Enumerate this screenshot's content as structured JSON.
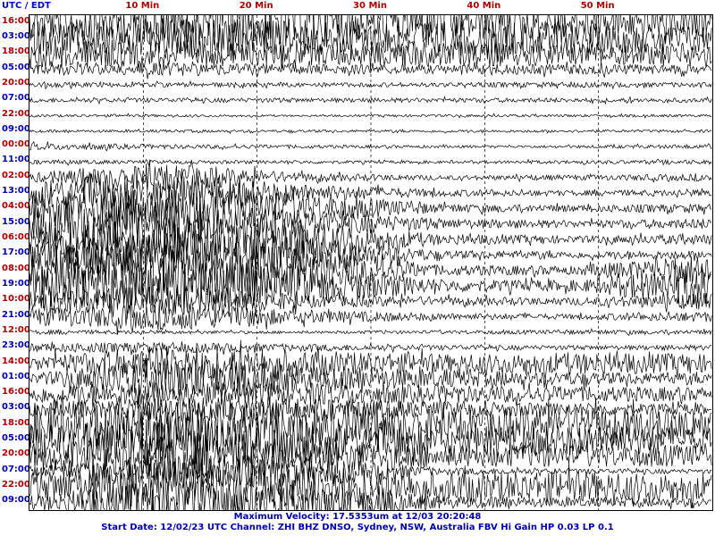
{
  "header": {
    "timezone_label": "UTC / EDT"
  },
  "footer": {
    "max_velocity_text": "Maximum Velocity: 17.5353um at 12/03 20:20:48",
    "info_text": "Start Date: 12/02/23 UTC Channel: ZHI  BHZ  DNSO, Sydney, NSW, Australia  FBV Hi Gain HP 0.03  LP 0.1"
  },
  "chart_data": {
    "type": "line",
    "title": "",
    "xlabel": "",
    "ylabel": "",
    "x_unit": "Min",
    "xlim": [
      0,
      60
    ],
    "x_ticks": [
      10,
      20,
      30,
      40,
      50
    ],
    "x_tick_labels": [
      "10 Min",
      "20 Min",
      "30 Min",
      "40 Min",
      "50 Min"
    ],
    "grid": "vertical dashed at 10-minute marks",
    "trace_color": "#000000",
    "utc_color": "#aa0000",
    "local_color": "#0000aa",
    "row_hour_labels": [
      {
        "utc": "16:00",
        "local": "03:00"
      },
      {
        "utc": "18:00",
        "local": "05:00"
      },
      {
        "utc": "20:00",
        "local": "07:00"
      },
      {
        "utc": "22:00",
        "local": "09:00"
      },
      {
        "utc": "00:00",
        "local": "11:00"
      },
      {
        "utc": "02:00",
        "local": "13:00"
      },
      {
        "utc": "04:00",
        "local": "15:00"
      },
      {
        "utc": "06:00",
        "local": "17:00"
      },
      {
        "utc": "08:00",
        "local": "19:00"
      },
      {
        "utc": "10:00",
        "local": "21:00"
      },
      {
        "utc": "12:00",
        "local": "23:00"
      },
      {
        "utc": "14:00",
        "local": "01:00"
      },
      {
        "utc": "16:00",
        "local": "03:00"
      },
      {
        "utc": "18:00",
        "local": "05:00"
      },
      {
        "utc": "20:00",
        "local": "07:00"
      },
      {
        "utc": "22:00",
        "local": "09:00"
      }
    ],
    "trace_amplitude": [
      [
        40,
        50,
        55,
        40,
        35,
        30
      ],
      [
        40,
        45,
        40,
        40,
        35,
        30
      ],
      [
        35,
        30,
        25,
        30,
        25,
        25
      ],
      [
        10,
        15,
        12,
        10,
        12,
        10
      ],
      [
        6,
        5,
        5,
        5,
        6,
        5
      ],
      [
        5,
        5,
        5,
        5,
        5,
        5
      ],
      [
        3,
        3,
        2,
        3,
        3,
        3
      ],
      [
        3,
        3,
        3,
        3,
        3,
        3
      ],
      [
        8,
        5,
        4,
        3,
        3,
        5
      ],
      [
        5,
        4,
        4,
        3,
        4,
        5
      ],
      [
        10,
        30,
        10,
        5,
        6,
        8
      ],
      [
        30,
        45,
        20,
        8,
        6,
        8
      ],
      [
        40,
        60,
        35,
        10,
        8,
        10
      ],
      [
        45,
        60,
        30,
        12,
        8,
        12
      ],
      [
        40,
        55,
        45,
        12,
        8,
        12
      ],
      [
        35,
        50,
        40,
        10,
        8,
        10
      ],
      [
        50,
        60,
        50,
        12,
        10,
        40
      ],
      [
        50,
        60,
        45,
        15,
        12,
        50
      ],
      [
        25,
        35,
        15,
        10,
        8,
        20
      ],
      [
        20,
        30,
        15,
        8,
        6,
        12
      ],
      [
        5,
        4,
        3,
        4,
        5,
        5
      ],
      [
        10,
        12,
        8,
        6,
        5,
        6
      ],
      [
        15,
        40,
        30,
        20,
        25,
        20
      ],
      [
        10,
        50,
        30,
        20,
        15,
        12
      ],
      [
        20,
        30,
        25,
        20,
        18,
        15
      ],
      [
        15,
        30,
        25,
        18,
        15,
        12
      ],
      [
        40,
        60,
        50,
        35,
        40,
        35
      ],
      [
        35,
        60,
        50,
        30,
        35,
        30
      ],
      [
        30,
        55,
        45,
        25,
        25,
        25
      ],
      [
        10,
        40,
        35,
        8,
        6,
        5
      ],
      [
        30,
        60,
        50,
        35,
        35,
        30
      ],
      [
        15,
        50,
        40,
        15,
        10,
        10
      ]
    ]
  }
}
